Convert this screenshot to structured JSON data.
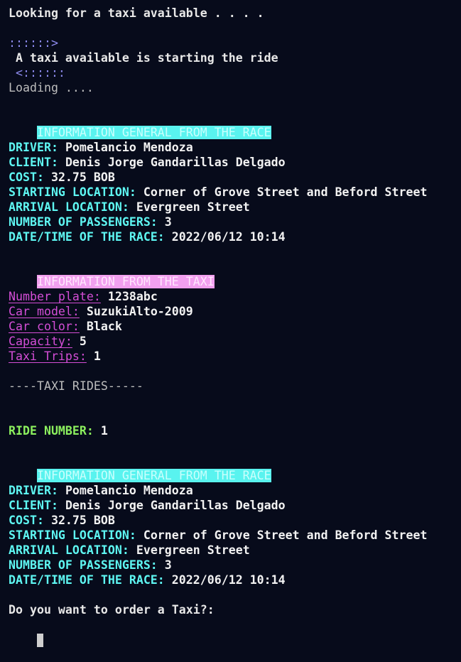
{
  "terminal": {
    "searching": "Looking for a taxi available . . . .",
    "arrow_right": "::::::>",
    "starting": " A taxi available is starting the ride",
    "arrow_left": " <::::::",
    "loading": "Loading ...."
  },
  "race_info": {
    "header": "INFORMATION GENERAL FROM THE RACE",
    "driver_label": "DRIVER:",
    "driver": "Pomelancio Mendoza",
    "client_label": "CLIENT:",
    "client": "Denis Jorge Gandarillas Delgado",
    "cost_label": "COST:",
    "cost": "32.75 BOB",
    "start_label": "STARTING LOCATION:",
    "start": "Corner of Grove Street and Beford Street",
    "arrival_label": "ARRIVAL LOCATION:",
    "arrival": "Evergreen Street",
    "passengers_label": "NUMBER OF PASSENGERS:",
    "passengers": "3",
    "datetime_label": "DATE/TIME OF THE RACE:",
    "datetime": "2022/06/12 10:14"
  },
  "taxi_info": {
    "header": "INFORMATION FROM THE TAXI",
    "plate_label": "Number plate:",
    "plate": "1238abc",
    "model_label": "Car model:",
    "model": "SuzukiAlto-2009",
    "color_label": "Car color:",
    "color": "Black",
    "capacity_label": "Capacity:",
    "capacity": "5",
    "trips_label": "Taxi Trips:",
    "trips": "1"
  },
  "rides": {
    "title": "----TAXI RIDES-----",
    "ride_number_label": "RIDE NUMBER:",
    "ride_number": "1",
    "header": "INFORMATION GENERAL FROM THE RACE",
    "driver_label": "DRIVER:",
    "driver": "Pomelancio Mendoza",
    "client_label": "CLIENT:",
    "client": "Denis Jorge Gandarillas Delgado",
    "cost_label": "COST:",
    "cost": "32.75 BOB",
    "start_label": "STARTING LOCATION:",
    "start": "Corner of Grove Street and Beford Street",
    "arrival_label": "ARRIVAL LOCATION:",
    "arrival": "Evergreen Street",
    "passengers_label": "NUMBER OF PASSENGERS:",
    "passengers": "3",
    "datetime_label": "DATE/TIME OF THE RACE:",
    "datetime": "2022/06/12 10:14"
  },
  "prompt": {
    "question": "Do you want to order a Taxi?:"
  },
  "colors": {
    "background": "#070b1b",
    "cyan_label": "#5ef6f2",
    "magenta_label": "#d44ed6",
    "green_label": "#8cf05e",
    "cyan_header_bg": "#59f3ef",
    "pink_header_bg": "#f2a0ef"
  }
}
